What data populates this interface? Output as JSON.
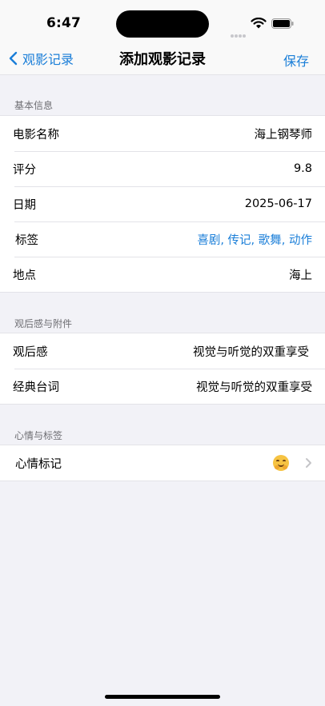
{
  "status": {
    "time": "6:47"
  },
  "nav": {
    "back_label": "观影记录",
    "title": "添加观影记录",
    "save_label": "保存"
  },
  "sections": [
    {
      "header": "基本信息",
      "rows": [
        {
          "label": "电影名称",
          "value": "海上钢琴师"
        },
        {
          "label": "评分",
          "value": "9.8"
        },
        {
          "label": "日期",
          "value": "2025-06-17"
        },
        {
          "label": "标签",
          "value": "喜剧, 传记, 歌舞, 动作"
        },
        {
          "label": "地点",
          "value": "海上"
        }
      ]
    },
    {
      "header": "观后感与附件",
      "rows": [
        {
          "label": "观后感",
          "value": "视觉与听觉的双重享受"
        },
        {
          "label": "经典台词",
          "value": "视觉与听觉的双重享受"
        }
      ]
    },
    {
      "header": "心情与标签",
      "rows": [
        {
          "label": "心情标记",
          "icon": "hugging-face-emoji"
        }
      ]
    }
  ],
  "colors": {
    "accent": "#1a7ed8",
    "background": "#f2f2f7"
  }
}
